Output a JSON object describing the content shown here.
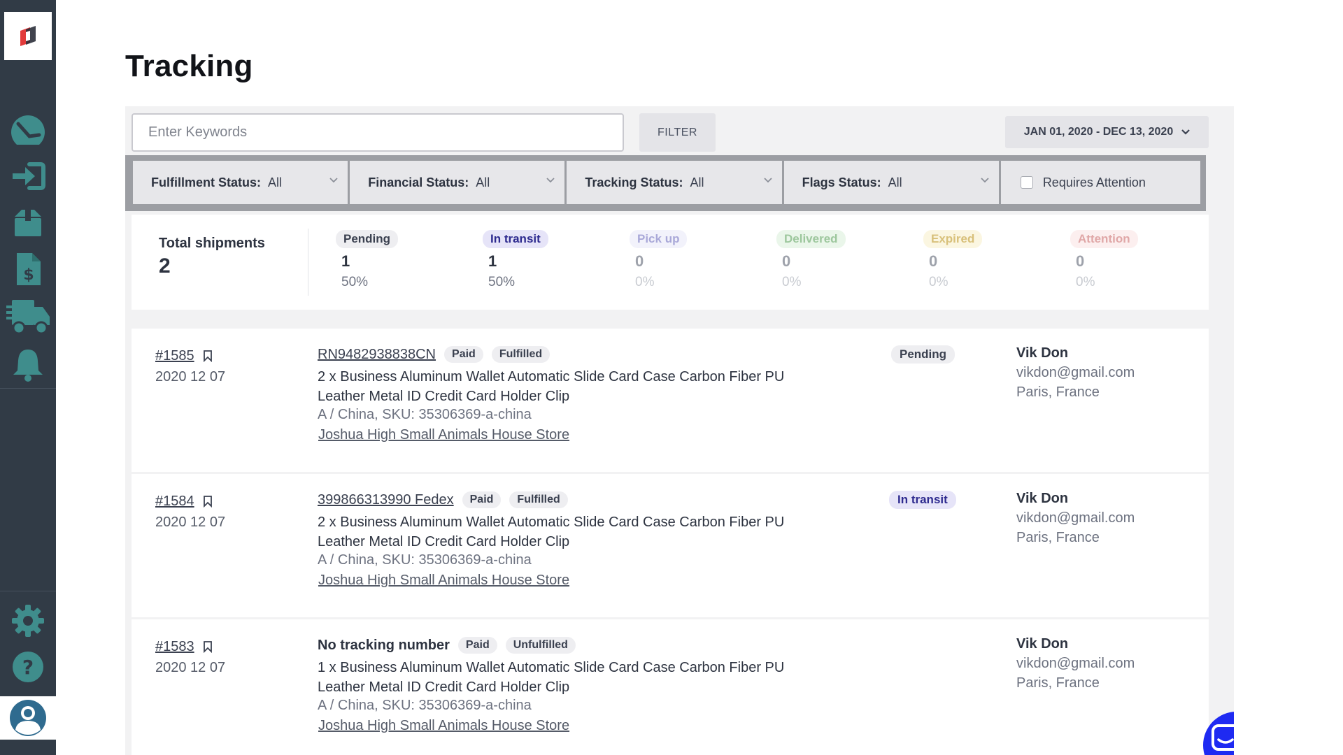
{
  "sidebar": {
    "logo": "app-logo",
    "items": [
      {
        "name": "dashboard",
        "icon": "route-icon"
      },
      {
        "name": "login",
        "icon": "login-arrow-icon"
      },
      {
        "name": "orders",
        "icon": "package-icon"
      },
      {
        "name": "invoices",
        "icon": "invoice-dollar-icon"
      },
      {
        "name": "shipping",
        "icon": "truck-icon"
      },
      {
        "name": "notifications",
        "icon": "bell-icon"
      }
    ],
    "bottom_items": [
      {
        "name": "settings",
        "icon": "gear-icon"
      },
      {
        "name": "help",
        "icon": "help-icon"
      },
      {
        "name": "profile",
        "icon": "user-avatar-icon"
      }
    ]
  },
  "page": {
    "title": "Tracking"
  },
  "toolbar": {
    "search_placeholder": "Enter Keywords",
    "search_value": "",
    "filter_label": "FILTER",
    "date_range": "JAN 01, 2020 - DEC 13, 2020"
  },
  "filters": {
    "fulfillment": {
      "label": "Fulfillment Status:",
      "value": "All"
    },
    "financial": {
      "label": "Financial Status:",
      "value": "All"
    },
    "tracking": {
      "label": "Tracking Status:",
      "value": "All"
    },
    "flags": {
      "label": "Flags Status:",
      "value": "All"
    },
    "requires_attention": {
      "label": "Requires Attention",
      "checked": false
    }
  },
  "summary": {
    "total_label": "Total shipments",
    "total_value": "2",
    "stats": [
      {
        "label": "Pending",
        "count": "1",
        "percent": "50%",
        "badge_bg": "#eeeef1",
        "badge_color": "#3b4150",
        "count_color": "#2d3340",
        "pct_color": "#6d7280"
      },
      {
        "label": "In transit",
        "count": "1",
        "percent": "50%",
        "badge_bg": "#e6e4f8",
        "badge_color": "#2e2b8f",
        "count_color": "#2d3340",
        "pct_color": "#6d7280"
      },
      {
        "label": "Pick up",
        "count": "0",
        "percent": "0%",
        "badge_bg": "#f2f2fb",
        "badge_color": "#a9a8d8",
        "count_color": "#9ea2ab",
        "pct_color": "#c8cbd1"
      },
      {
        "label": "Delivered",
        "count": "0",
        "percent": "0%",
        "badge_bg": "#eaf6ea",
        "badge_color": "#9dc79d",
        "count_color": "#9ea2ab",
        "pct_color": "#c8cbd1"
      },
      {
        "label": "Expired",
        "count": "0",
        "percent": "0%",
        "badge_bg": "#fbf6e1",
        "badge_color": "#d8c07a",
        "count_color": "#9ea2ab",
        "pct_color": "#c8cbd1"
      },
      {
        "label": "Attention",
        "count": "0",
        "percent": "0%",
        "badge_bg": "#fcefef",
        "badge_color": "#e0a7a7",
        "count_color": "#9ea2ab",
        "pct_color": "#c8cbd1"
      }
    ]
  },
  "shipments": [
    {
      "order_id": "#1585",
      "date": "2020 12 07",
      "tracking": "RN9482938838CN",
      "has_tracking": true,
      "financial": "Paid",
      "fulfillment": "Fulfilled",
      "product": "2 x Business Aluminum Wallet Automatic Slide Card Case Carbon Fiber PU Leather Metal ID Credit Card Holder Clip",
      "variant": "A / China, SKU: 35306369-a-china",
      "store": "Joshua High Small Animals House Store",
      "status": "Pending",
      "status_bg": "#eeeef1",
      "status_color": "#3b4150",
      "customer_name": "Vik Don",
      "customer_email": "vikdon@gmail.com",
      "customer_location": "Paris, France"
    },
    {
      "order_id": "#1584",
      "date": "2020 12 07",
      "tracking": "399866313990 Fedex",
      "has_tracking": true,
      "financial": "Paid",
      "fulfillment": "Fulfilled",
      "product": "2 x Business Aluminum Wallet Automatic Slide Card Case Carbon Fiber PU Leather Metal ID Credit Card Holder Clip",
      "variant": "A / China, SKU: 35306369-a-china",
      "store": "Joshua High Small Animals House Store",
      "status": "In transit",
      "status_bg": "#e6e4f8",
      "status_color": "#2e2b8f",
      "customer_name": "Vik Don",
      "customer_email": "vikdon@gmail.com",
      "customer_location": "Paris, France"
    },
    {
      "order_id": "#1583",
      "date": "2020 12 07",
      "tracking": "No tracking number",
      "has_tracking": false,
      "financial": "Paid",
      "fulfillment": "Unfulfilled",
      "product": "1 x Business Aluminum Wallet Automatic Slide Card Case Carbon Fiber PU Leather Metal ID Credit Card Holder Clip",
      "variant": "A / China, SKU: 35306369-a-china",
      "store": "Joshua High Small Animals House Store",
      "status": "",
      "status_bg": "",
      "status_color": "",
      "customer_name": "Vik Don",
      "customer_email": "vikdon@gmail.com",
      "customer_location": "Paris, France"
    }
  ],
  "chat_widget": {
    "icon": "chat-bubble-icon",
    "color": "#1e2af2"
  }
}
